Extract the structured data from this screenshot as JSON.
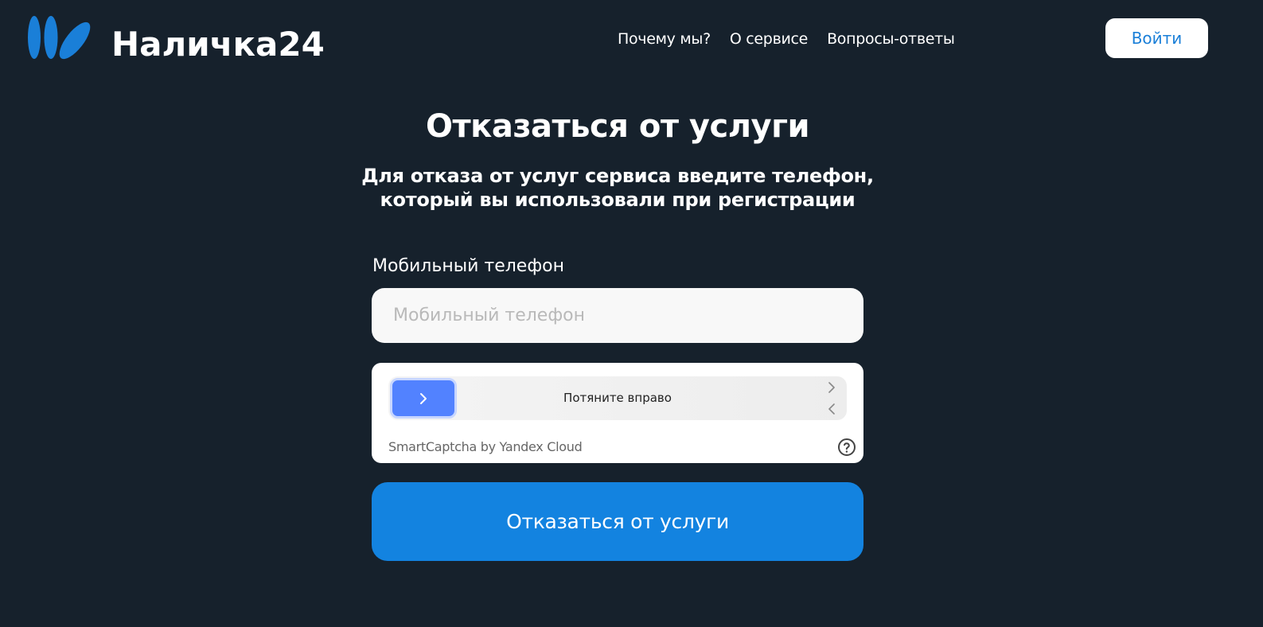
{
  "header": {
    "brand": "Наличка24",
    "nav": [
      {
        "label": "Почему мы?"
      },
      {
        "label": "О сервисе"
      },
      {
        "label": "Вопросы-ответы"
      }
    ],
    "login_label": "Войти"
  },
  "main": {
    "title": "Отказаться от услуги",
    "subtitle": "Для отказа от услуг сервиса введите телефон, который вы использовали при регистрации",
    "phone_label": "Мобильный телефон",
    "phone_placeholder": "Мобильный телефон",
    "phone_value": "",
    "captcha": {
      "slider_text": "Потяните вправо",
      "brand": "SmartCaptcha by Yandex Cloud",
      "handle_color": "#5282ff"
    },
    "submit_label": "Отказаться от услуги"
  },
  "colors": {
    "background": "#16212c",
    "accent": "#1383e0",
    "brand_blue": "#1a7fd8"
  },
  "icons": {
    "logo": "brand-logo-icon",
    "slider_handle": "chevron-right-icon",
    "slider_right": "chevron-right-icon",
    "slider_left": "chevron-left-icon",
    "help": "question-circle-icon"
  }
}
